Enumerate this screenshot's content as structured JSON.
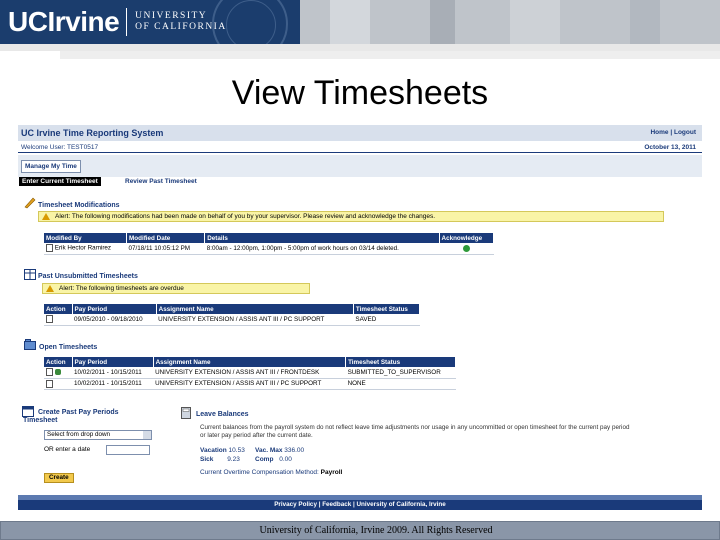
{
  "banner": {
    "brand": "UCIrvine",
    "university_line1": "UNIVERSITY",
    "university_line2": "OF CALIFORNIA",
    "background_color": "#1b3d6d"
  },
  "slide": {
    "title": "View Timesheets",
    "copyright": "University of California, Irvine 2009. All Rights Reserved"
  },
  "app": {
    "title": "UC Irvine Time Reporting System",
    "top_links": "Home | Logout",
    "welcome": "Welcome User: TEST0517",
    "date": "October 13, 2011",
    "nav_tab": "Manage My Time",
    "subnav_active": "Enter Current Timesheet",
    "subnav_link": "Review Past Timesheet",
    "accent_color": "#1a3a7a",
    "alert_color": "#f9f4a6"
  },
  "modifications": {
    "heading": "Timesheet Modifications",
    "alert": "Alert: The following modifications had been made on behalf of you by your supervisor. Please review and acknowledge the changes.",
    "columns": [
      "Modified By",
      "Modified Date",
      "Details",
      "Acknowledge"
    ],
    "rows": [
      {
        "by": "Erik Hector Ramirez",
        "date": "07/18/11 10:05:12 PM",
        "details": "8:00am - 12:00pm, 1:00pm - 5:00pm of work hours on 03/14 deleted."
      }
    ]
  },
  "unsubmitted": {
    "heading": "Past Unsubmitted Timesheets",
    "alert": "Alert: The following timesheets are overdue",
    "columns": [
      "Action",
      "Pay Period",
      "Assignment Name",
      "Timesheet Status"
    ],
    "rows": [
      {
        "period": "09/05/2010 - 09/18/2010",
        "assignment": "UNIVERSITY EXTENSION / ASSIS ANT III / PC SUPPORT",
        "status": "SAVED"
      }
    ]
  },
  "open": {
    "heading": "Open Timesheets",
    "columns": [
      "Action",
      "Pay Period",
      "Assignment Name",
      "Timesheet Status"
    ],
    "rows": [
      {
        "period": "10/02/2011 - 10/15/2011",
        "assignment": "UNIVERSITY EXTENSION / ASSIS ANT III / FRONTDESK",
        "status": "SUBMITTED_TO_SUPERVISOR"
      },
      {
        "period": "10/02/2011 - 10/15/2011",
        "assignment": "UNIVERSITY EXTENSION / ASSIS ANT III / PC SUPPORT",
        "status": "NONE"
      }
    ]
  },
  "create": {
    "heading_line1": "Create Past Pay Periods",
    "heading_line2": "Timesheet",
    "select_value": "Select from drop down",
    "or_label": "OR enter a date",
    "button": "Create"
  },
  "leave": {
    "heading": "Leave Balances",
    "note": "Current balances from the payroll system do not reflect leave time adjustments nor usage in any uncommitted or open timesheet for the current pay period or later pay period after the current date.",
    "vacation_label": "Vacation",
    "vacation_value": "10.53",
    "vac_max_label": "Vac. Max",
    "vac_max_value": "336.00",
    "sick_label": "Sick",
    "sick_value": "9.23",
    "comp_label": "Comp",
    "comp_value": "0.00",
    "overtime_label": "Current Overtime Compensation Method:",
    "overtime_value": "Payroll"
  },
  "footer": {
    "links": "Privacy Policy | Feedback | University of California, Irvine"
  }
}
